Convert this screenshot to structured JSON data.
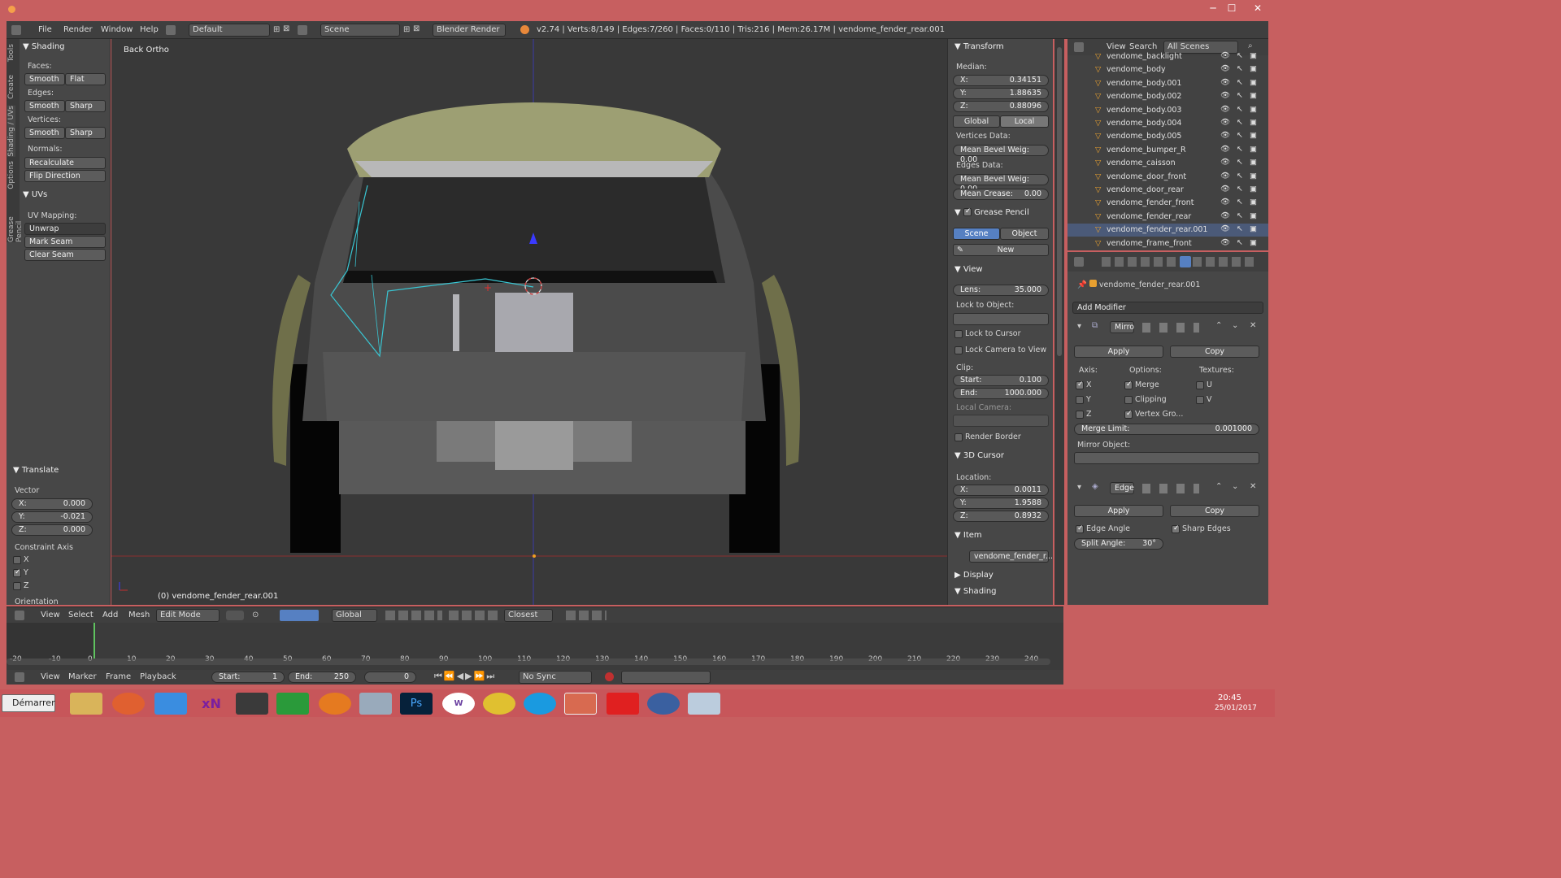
{
  "window": {
    "minimize": "─",
    "maximize": "☐",
    "close": "✕"
  },
  "topbar": {
    "menus": [
      "File",
      "Render",
      "Window",
      "Help"
    ],
    "layout": "Default",
    "scene": "Scene",
    "engine": "Blender Render",
    "stats": "v2.74 | Verts:8/149 | Edges:7/260 | Faces:0/110 | Tris:216 | Mem:26.17M | vendome_fender_rear.001"
  },
  "toolshelf": {
    "tabs": [
      "Tools",
      "Create",
      "Shading / UVs",
      "Options",
      "Grease Pencil"
    ],
    "shading": {
      "title": "Shading",
      "faces": "Faces:",
      "smooth": "Smooth",
      "flat": "Flat",
      "edges": "Edges:",
      "sharp": "Sharp",
      "vertices": "Vertices:",
      "normals": "Normals:",
      "recalc": "Recalculate",
      "flip": "Flip Direction"
    },
    "uvs": {
      "title": "UVs",
      "mapping": "UV Mapping:",
      "unwrap": "Unwrap",
      "mark": "Mark Seam",
      "clear": "Clear Seam"
    },
    "translate": {
      "title": "Translate",
      "vector": "Vector",
      "x": "X:",
      "xv": "0.000",
      "y": "Y:",
      "yv": "-0.021",
      "z": "Z:",
      "zv": "0.000",
      "constraint": "Constraint Axis",
      "cx": "X",
      "cy": "Y",
      "cz": "Z",
      "orientation": "Orientation"
    }
  },
  "viewport": {
    "label": "Back Ortho",
    "object": "(0) vendome_fender_rear.001"
  },
  "npanel": {
    "transform": "Transform",
    "median": "Median:",
    "x": "X:",
    "xv": "0.34151",
    "y": "Y:",
    "yv": "1.88635",
    "z": "Z:",
    "zv": "0.88096",
    "global": "Global",
    "local": "Local",
    "vdata": "Vertices Data:",
    "mbw": "Mean Bevel Weig: 0.00",
    "edata": "Edges Data:",
    "mbw2": "Mean Bevel Weig: 0.00",
    "crease": "Mean Crease:",
    "creasev": "0.00",
    "gp": "Grease Pencil",
    "scene": "Scene",
    "object": "Object",
    "new": "New",
    "view": "View",
    "lens": "Lens:",
    "lensv": "35.000",
    "lockobj": "Lock to Object:",
    "lockcursor": "Lock to Cursor",
    "lockcam": "Lock Camera to View",
    "clip": "Clip:",
    "start": "Start:",
    "startv": "0.100",
    "end": "End:",
    "endv": "1000.000",
    "localcam": "Local Camera:",
    "border": "Render Border",
    "cursor": "3D Cursor",
    "location": "Location:",
    "cx": "0.0011",
    "cy": "1.9588",
    "cz": "0.8932",
    "item": "Item",
    "itemname": "vendome_fender_r...",
    "display": "Display",
    "shading": "Shading"
  },
  "outliner": {
    "view": "View",
    "search": "Search",
    "scenes": "All Scenes",
    "items": [
      "vendome_backlight",
      "vendome_body",
      "vendome_body.001",
      "vendome_body.002",
      "vendome_body.003",
      "vendome_body.004",
      "vendome_body.005",
      "vendome_bumper_R",
      "vendome_caisson",
      "vendome_door_front",
      "vendome_door_rear",
      "vendome_fender_front",
      "vendome_fender_rear",
      "vendome_fender_rear.001",
      "vendome_frame_front"
    ]
  },
  "props": {
    "object": "vendome_fender_rear.001",
    "addmod": "Add Modifier",
    "mirror": "Mirro",
    "apply": "Apply",
    "copy": "Copy",
    "axis": "Axis:",
    "options": "Options:",
    "textures": "Textures:",
    "x": "X",
    "y": "Y",
    "z": "Z",
    "merge": "Merge",
    "clipping": "Clipping",
    "vgroup": "Vertex Gro...",
    "u": "U",
    "v": "V",
    "mergelimit": "Merge Limit:",
    "mergelimitv": "0.001000",
    "mirrorobj": "Mirror Object:",
    "edge": "Edge",
    "apply2": "Apply",
    "copy2": "Copy",
    "edgeangle": "Edge Angle",
    "sharpedges": "Sharp Edges",
    "split": "Split Angle:",
    "splitv": "30°"
  },
  "vhdr": {
    "view": "View",
    "select": "Select",
    "add": "Add",
    "mesh": "Mesh",
    "mode": "Edit Mode",
    "orient": "Global",
    "snap": "Closest"
  },
  "timeline": {
    "ticks": [
      "-20",
      "-10",
      "0",
      "10",
      "20",
      "30",
      "40",
      "50",
      "60",
      "70",
      "80",
      "90",
      "100",
      "110",
      "120",
      "130",
      "140",
      "150",
      "160",
      "170",
      "180",
      "190",
      "200",
      "210",
      "220",
      "230",
      "240"
    ]
  },
  "tlhdr": {
    "view": "View",
    "marker": "Marker",
    "frame": "Frame",
    "playback": "Playback",
    "start": "Start:",
    "startv": "1",
    "end": "End:",
    "endv": "250",
    "cur": "0",
    "sync": "No Sync"
  },
  "taskbar": {
    "start": "Démarrer",
    "time": "20:45",
    "date": "25/01/2017"
  }
}
